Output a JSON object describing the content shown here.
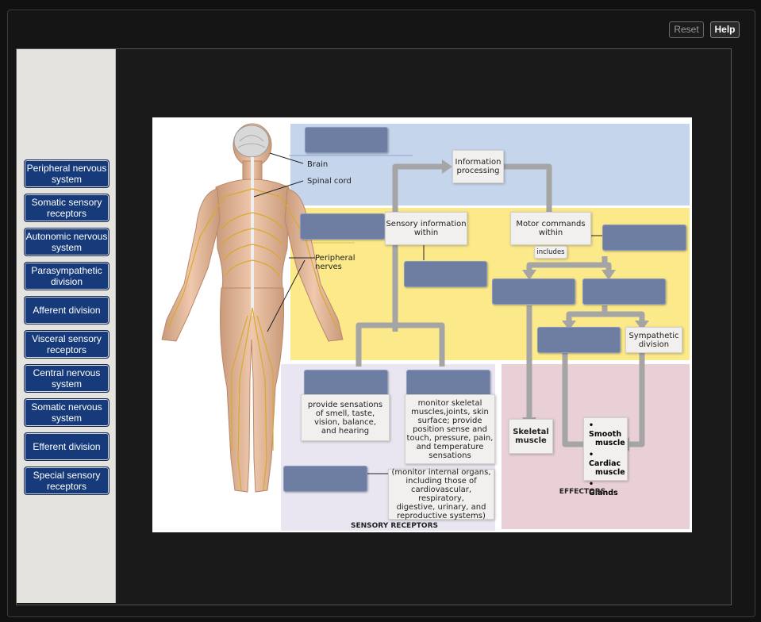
{
  "toolbar": {
    "reset_label": "Reset",
    "help_label": "Help"
  },
  "labels": [
    "Peripheral nervous system",
    "Somatic sensory receptors",
    "Autonomic nervous system",
    "Parasympathetic division",
    "Afferent division",
    "Visceral sensory receptors",
    "Central nervous system",
    "Somatic nervous system",
    "Efferent division",
    "Special sensory receptors"
  ],
  "diagram": {
    "body": {
      "brain": "Brain",
      "spinal_cord": "Spinal cord",
      "peripheral_nerves_1": "Peripheral",
      "peripheral_nerves_2": "nerves"
    },
    "info_processing_1": "Information",
    "info_processing_2": "processing",
    "sensory_info_1": "Sensory information",
    "sensory_info_2": "within",
    "motor_cmd_1": "Motor commands",
    "motor_cmd_2": "within",
    "includes": "includes",
    "sympathetic_1": "Sympathetic",
    "sympathetic_2": "division",
    "special_desc": [
      "provide sensations",
      "of smell, taste,",
      "vision, balance,",
      "and hearing"
    ],
    "somatic_desc": [
      "monitor skeletal",
      "muscles,joints, skin",
      "surface; provide",
      "position sense and",
      "touch, pressure, pain,",
      "and temperature",
      "sensations"
    ],
    "visceral_desc": [
      "(monitor internal organs,",
      "including those of",
      "cardiovascular, respiratory,",
      "digestive, urinary, and",
      "reproductive systems)"
    ],
    "skeletal_1": "Skeletal",
    "skeletal_2": "muscle",
    "effectors": [
      "• Smooth",
      "muscle",
      "• Cardiac",
      "muscle",
      "• Glands"
    ],
    "effectors_title": "EFFECTORS",
    "sensory_receptors_title": "SENSORY RECEPTORS"
  },
  "colors": {
    "blue_region": "#c5d6ec",
    "yellow_region": "#fbe98a",
    "lavender_region": "#e9e6f1",
    "pink_region": "#e8d0d6",
    "drop_zone": "#6d7ea2",
    "label_tile": "#173b7a"
  }
}
